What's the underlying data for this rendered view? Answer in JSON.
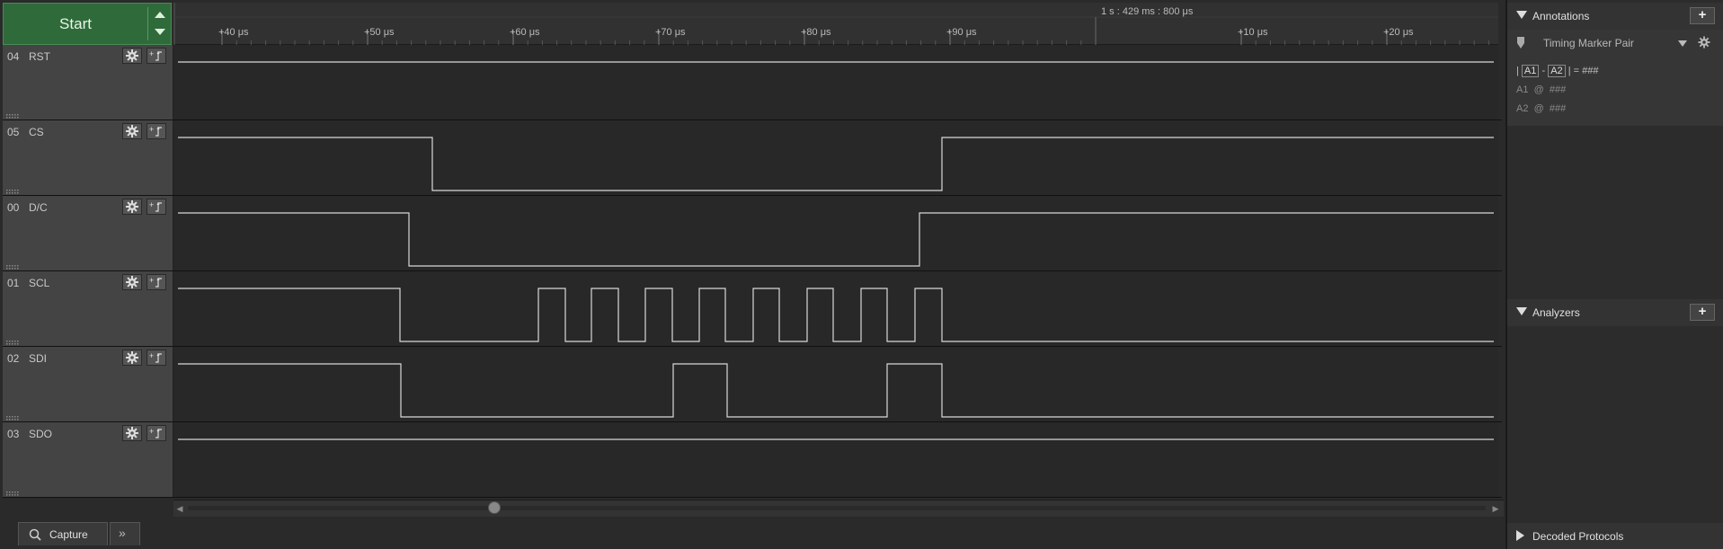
{
  "toolbar": {
    "start_label": "Start"
  },
  "ruler": {
    "top_time": "1 s : 429 ms : 800 μs",
    "ticks": [
      "+40 μs",
      "+50 μs",
      "+60 μs",
      "+70 μs",
      "+80 μs",
      "+90 μs",
      "+10 μs",
      "+20 μs"
    ]
  },
  "channels": [
    {
      "num": "04",
      "name": "RST",
      "color": "#d4c21d",
      "wave": [
        [
          0,
          1
        ]
      ]
    },
    {
      "num": "05",
      "name": "CS",
      "color": "#5aa32c",
      "wave": [
        [
          0,
          1
        ],
        [
          283,
          0
        ],
        [
          850,
          1
        ]
      ]
    },
    {
      "num": "00",
      "name": "D/C",
      "color": "#c0c0c0",
      "wave": [
        [
          0,
          1
        ],
        [
          257,
          0
        ],
        [
          825,
          1
        ]
      ]
    },
    {
      "num": "01",
      "name": "SCL",
      "color": "#8a4a22",
      "wave": [
        [
          0,
          1
        ],
        [
          247,
          0
        ],
        [
          401,
          1
        ],
        [
          431,
          0
        ],
        [
          460,
          1
        ],
        [
          490,
          0
        ],
        [
          520,
          1
        ],
        [
          550,
          0
        ],
        [
          580,
          1
        ],
        [
          609,
          0
        ],
        [
          640,
          1
        ],
        [
          669,
          0
        ],
        [
          700,
          1
        ],
        [
          729,
          0
        ],
        [
          760,
          1
        ],
        [
          789,
          0
        ],
        [
          820,
          1
        ],
        [
          850,
          0
        ]
      ]
    },
    {
      "num": "02",
      "name": "SDI",
      "color": "#c8282a",
      "wave": [
        [
          0,
          1
        ],
        [
          248,
          0
        ],
        [
          551,
          1
        ],
        [
          611,
          0
        ],
        [
          789,
          1
        ],
        [
          850,
          0
        ]
      ]
    },
    {
      "num": "03",
      "name": "SDO",
      "color": "#e08a1a",
      "wave": [
        [
          0,
          1
        ]
      ]
    }
  ],
  "bottom": {
    "capture_label": "Capture",
    "more_label": "»"
  },
  "annotations": {
    "title": "Annotations",
    "add": "+",
    "marker": {
      "name": "Timing Marker Pair",
      "line1_pipe1": "|",
      "a1": "A1",
      "dash": "-",
      "a2": "A2",
      "line1_eq": "| = ###",
      "line2": "A1  @  ###",
      "line3": "A2  @  ###"
    }
  },
  "analyzers": {
    "title": "Analyzers",
    "add": "+"
  },
  "decoded": {
    "title": "Decoded Protocols"
  }
}
